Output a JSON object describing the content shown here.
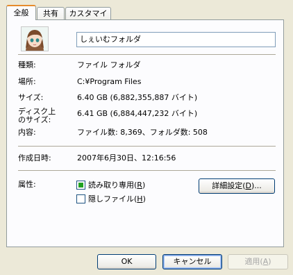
{
  "tabs": [
    {
      "label": "全般"
    },
    {
      "label": "共有"
    },
    {
      "label": "カスタマイズ"
    }
  ],
  "folder_name": "しぇいむフォルダ",
  "properties": [
    {
      "label": "種類:",
      "value": "ファイル フォルダ"
    },
    {
      "label": "場所:",
      "value": "C:¥Program Files"
    },
    {
      "label": "サイズ:",
      "value": "6.40 GB (6,882,355,887 バイト)"
    },
    {
      "label": "ディスク上\nのサイズ:",
      "value": "6.41 GB (6,884,447,232 バイト)"
    },
    {
      "label": "内容:",
      "value": "ファイル数: 8,369、フォルダ数: 508"
    }
  ],
  "created": {
    "label": "作成日時:",
    "value": "2007年6月30日、12:16:56"
  },
  "attributes": {
    "label": "属性:",
    "readonly": {
      "text": "読み取り専用(",
      "key": "R",
      "end": ")",
      "state": "indeterminate"
    },
    "hidden": {
      "text": "隠しファイル(",
      "key": "H",
      "end": ")",
      "state": "unchecked"
    },
    "advanced_button": {
      "text": "詳細設定(",
      "key": "D",
      "end": ")..."
    }
  },
  "buttons": {
    "ok": "OK",
    "cancel": "キャンセル",
    "apply": {
      "text": "適用(",
      "key": "A",
      "end": ")"
    }
  },
  "colors": {
    "active_tab_accent": "#e68b2c",
    "readonly_indeterminate": "#21a121"
  }
}
